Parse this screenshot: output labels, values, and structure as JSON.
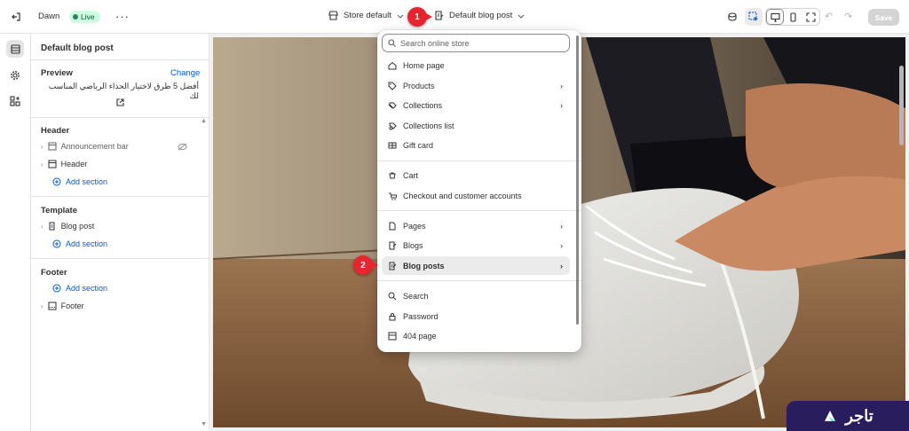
{
  "topbar": {
    "theme_name": "Dawn",
    "live_badge": "Live",
    "store_selector": "Store default",
    "page_selector": "Default blog post",
    "save_label": "Save"
  },
  "callouts": [
    "1",
    "2"
  ],
  "sidebar": {
    "title": "Default blog post",
    "preview_heading": "Preview",
    "change_link": "Change",
    "preview_text": "أفضل 5 طرق لاختيار الحذاء الرياضي المناسب لك",
    "header_heading": "Header",
    "announcement_bar": "Announcement bar",
    "header_item": "Header",
    "add_section": "Add section",
    "template_heading": "Template",
    "blog_post_item": "Blog post",
    "footer_heading": "Footer",
    "footer_item": "Footer"
  },
  "dropdown": {
    "search_placeholder": "Search online store",
    "items": [
      {
        "label": "Home page",
        "icon": "home-icon"
      },
      {
        "label": "Products",
        "icon": "tag-icon"
      },
      {
        "label": "Collections",
        "icon": "collection-icon"
      },
      {
        "label": "Collections list",
        "icon": "collections-list-icon"
      },
      {
        "label": "Gift card",
        "icon": "gift-card-icon"
      },
      {
        "label": "Cart",
        "icon": "cart-icon"
      },
      {
        "label": "Checkout and customer accounts",
        "icon": "checkout-icon"
      },
      {
        "label": "Pages",
        "icon": "page-icon"
      },
      {
        "label": "Blogs",
        "icon": "blog-icon"
      },
      {
        "label": "Blog posts",
        "icon": "blog-post-icon"
      },
      {
        "label": "Search",
        "icon": "search-icon"
      },
      {
        "label": "Password",
        "icon": "lock-icon"
      },
      {
        "label": "404 page",
        "icon": "404-icon"
      }
    ]
  },
  "brand": {
    "name": "تاجر",
    "color": "#2a1d5e"
  },
  "colors": {
    "accent": "#005bd3",
    "live": "#29845a",
    "callout": "#e8242f"
  }
}
